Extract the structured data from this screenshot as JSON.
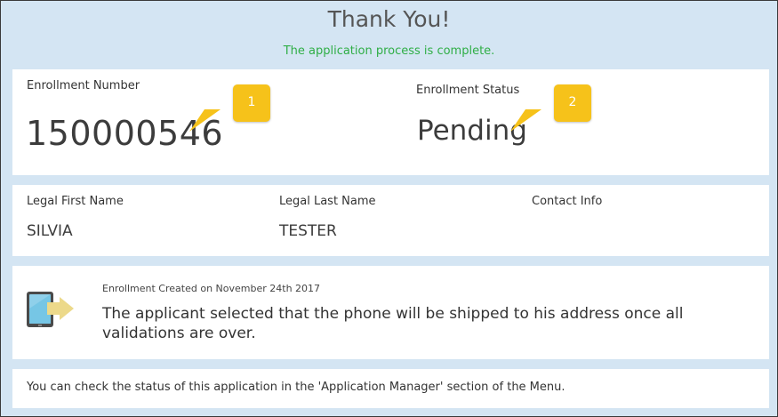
{
  "header": {
    "title": "Thank You!",
    "subtitle": "The application process is complete."
  },
  "enrollment": {
    "number_label": "Enrollment Number",
    "number_value": "150000546",
    "status_label": "Enrollment Status",
    "status_value": "Pending",
    "callout_1": "1",
    "callout_2": "2"
  },
  "applicant": {
    "first_name_label": "Legal First Name",
    "first_name_value": "SILVIA",
    "last_name_label": "Legal Last Name",
    "last_name_value": "TESTER",
    "contact_label": "Contact Info"
  },
  "shipping": {
    "icon": "phone-arrow-icon",
    "created_text": "Enrollment Created on November 24th 2017",
    "message": "The applicant selected that the phone will be shipped to his address once all validations are over."
  },
  "footer": {
    "note": "You can check the status of this application in the 'Application Manager' section of the Menu."
  },
  "colors": {
    "background": "#d4e5f3",
    "success_text": "#2fae46",
    "callout": "#f6c21a"
  }
}
